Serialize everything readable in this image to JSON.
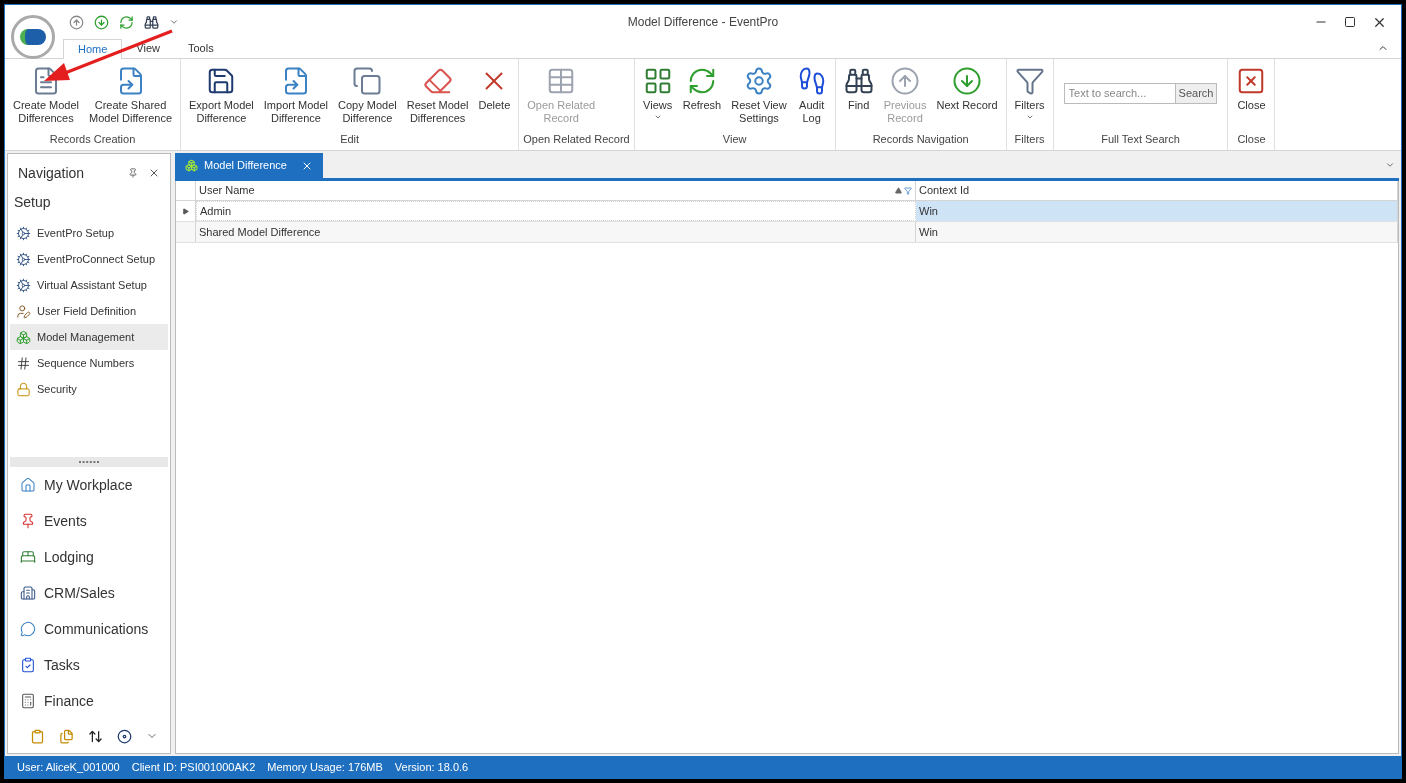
{
  "window": {
    "title": "Model Difference - EventPro"
  },
  "ribbon_tabs": [
    {
      "label": "Home",
      "selected": true
    },
    {
      "label": "View",
      "selected": false
    },
    {
      "label": "Tools",
      "selected": false
    }
  ],
  "ribbon_groups": [
    {
      "title": "Records Creation",
      "buttons": [
        {
          "kind": "doc",
          "label": [
            "Create Model",
            "Differences"
          ],
          "disabled": false,
          "dropdown": false
        },
        {
          "kind": "share",
          "label": [
            "Create Shared",
            "Model Difference"
          ],
          "disabled": false,
          "dropdown": false
        }
      ]
    },
    {
      "title": "Edit",
      "buttons": [
        {
          "kind": "save",
          "label": [
            "Export Model",
            "Difference"
          ],
          "disabled": false,
          "dropdown": false
        },
        {
          "kind": "share",
          "label": [
            "Import Model",
            "Difference"
          ],
          "disabled": false,
          "dropdown": false
        },
        {
          "kind": "copy",
          "label": [
            "Copy Model",
            "Difference"
          ],
          "disabled": false,
          "dropdown": false
        },
        {
          "kind": "eraser",
          "label": [
            "Reset Model",
            "Differences"
          ],
          "disabled": false,
          "dropdown": false
        },
        {
          "kind": "delete",
          "label": [
            "Delete"
          ],
          "disabled": false,
          "dropdown": false
        }
      ]
    },
    {
      "title": "Open Related Record",
      "buttons": [
        {
          "kind": "table",
          "label": [
            "Open Related",
            "Record"
          ],
          "disabled": true,
          "dropdown": false
        }
      ]
    },
    {
      "title": "View",
      "buttons": [
        {
          "kind": "grid",
          "label": [
            "Views"
          ],
          "disabled": false,
          "dropdown": true
        },
        {
          "kind": "refresh",
          "label": [
            "Refresh"
          ],
          "disabled": false,
          "dropdown": false
        },
        {
          "kind": "settings",
          "label": [
            "Reset View",
            "Settings"
          ],
          "disabled": false,
          "dropdown": false
        },
        {
          "kind": "footprints",
          "label": [
            "Audit",
            "Log"
          ],
          "disabled": false,
          "dropdown": false
        }
      ]
    },
    {
      "title": "Records Navigation",
      "buttons": [
        {
          "kind": "find",
          "label": [
            "Find"
          ],
          "disabled": false,
          "dropdown": false
        },
        {
          "kind": "up",
          "label": [
            "Previous",
            "Record"
          ],
          "disabled": true,
          "dropdown": false
        },
        {
          "kind": "down",
          "label": [
            "Next Record"
          ],
          "disabled": false,
          "dropdown": false
        }
      ]
    },
    {
      "title": "Filters",
      "buttons": [
        {
          "kind": "filter",
          "label": [
            "Filters"
          ],
          "disabled": false,
          "dropdown": true
        }
      ]
    },
    {
      "title": "Full Text Search",
      "search": {
        "placeholder": "Text to search...",
        "button": "Search"
      }
    },
    {
      "title": "Close",
      "buttons": [
        {
          "kind": "close",
          "label": [
            "Close"
          ],
          "disabled": false,
          "dropdown": false
        }
      ]
    }
  ],
  "navigation": {
    "title": "Navigation",
    "section": "Setup",
    "items": [
      {
        "kind": "gear",
        "label": "EventPro Setup",
        "selected": false
      },
      {
        "kind": "gear",
        "label": "EventProConnect Setup",
        "selected": false
      },
      {
        "kind": "gear",
        "label": "Virtual Assistant Setup",
        "selected": false
      },
      {
        "kind": "user",
        "label": "User Field Definition",
        "selected": false
      },
      {
        "kind": "model",
        "label": "Model Management",
        "selected": true
      },
      {
        "kind": "hash",
        "label": "Sequence Numbers",
        "selected": false
      },
      {
        "kind": "lock",
        "label": "Security",
        "selected": false
      }
    ],
    "modules": [
      {
        "kind": "home",
        "label": "My Workplace"
      },
      {
        "kind": "pin",
        "label": "Events"
      },
      {
        "kind": "bed",
        "label": "Lodging"
      },
      {
        "kind": "building",
        "label": "CRM/Sales"
      },
      {
        "kind": "chat",
        "label": "Communications"
      },
      {
        "kind": "clipboard",
        "label": "Tasks"
      },
      {
        "kind": "calculator",
        "label": "Finance"
      }
    ]
  },
  "document_tab": {
    "label": "Model Difference"
  },
  "table": {
    "columns": [
      {
        "label": "User Name",
        "sorted": true
      },
      {
        "label": "Context Id",
        "sorted": false
      }
    ],
    "rows": [
      {
        "selected": true,
        "cells": [
          "Admin",
          "Win"
        ]
      },
      {
        "selected": false,
        "cells": [
          "Shared Model Difference",
          "Win"
        ]
      }
    ]
  },
  "status_bar": [
    "User: AliceK_001000",
    "Client ID: PSI001000AK2",
    "Memory Usage: 176MB",
    "Version: 18.0.6"
  ]
}
